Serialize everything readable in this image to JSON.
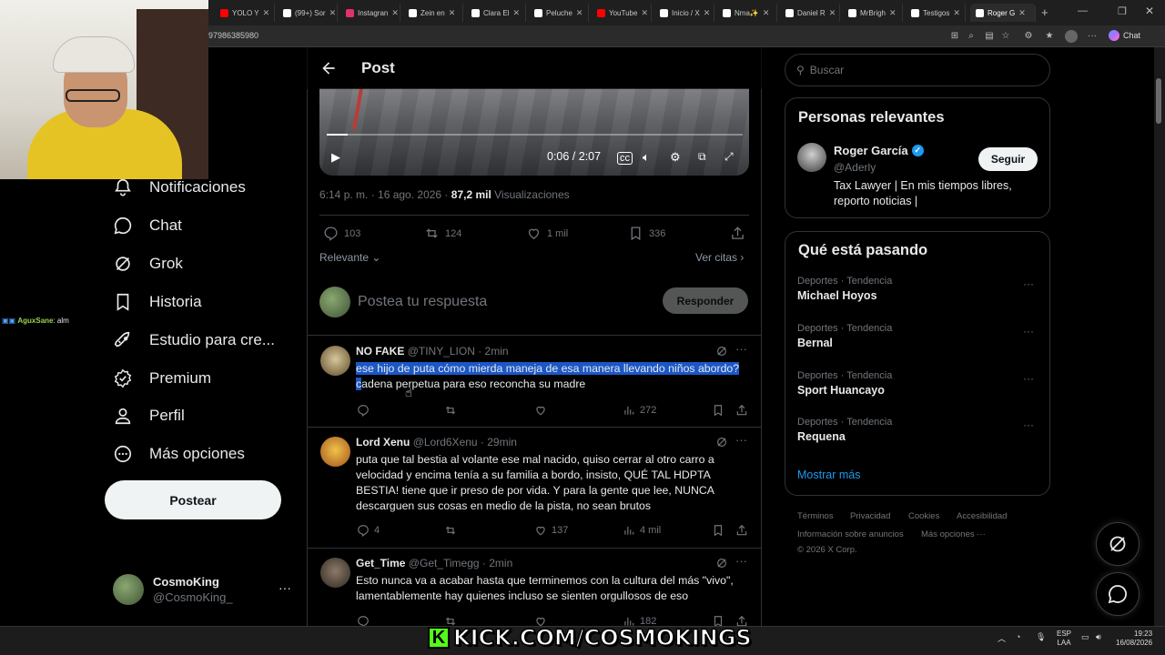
{
  "browser": {
    "tabs": [
      {
        "label": "YOLO Y",
        "color": "#ff0000",
        "active": false
      },
      {
        "label": "(99+) Sor",
        "color": "#ffffff",
        "active": false
      },
      {
        "label": "Instagran",
        "color": "#e1306c",
        "active": false
      },
      {
        "label": "Zein en",
        "color": "#ffffff",
        "active": false
      },
      {
        "label": "Clara El",
        "color": "#ffffff",
        "active": false
      },
      {
        "label": "Peluche",
        "color": "#ffffff",
        "active": false
      },
      {
        "label": "YouTube",
        "color": "#ff0000",
        "active": false
      },
      {
        "label": "Inicio / X",
        "color": "#ffffff",
        "active": false
      },
      {
        "label": "Nma✨",
        "color": "#ffffff",
        "active": false
      },
      {
        "label": "Daniel R",
        "color": "#ffffff",
        "active": false
      },
      {
        "label": "MrBrigh",
        "color": "#ffffff",
        "active": false
      },
      {
        "label": "Testigos",
        "color": "#ffffff",
        "active": false
      },
      {
        "label": "Roger G",
        "color": "#ffffff",
        "active": true
      }
    ],
    "url": "97986385980",
    "chat_label": "Chat"
  },
  "stream": {
    "chat_user": "AguxSane",
    "chat_msg": ": alm",
    "banner": "KICK.COM/COSMOKINGS",
    "banner_k": "K"
  },
  "nav": {
    "items": [
      {
        "label": "Notificaciones",
        "icon": "bell-icon"
      },
      {
        "label": "Chat",
        "icon": "chat-icon"
      },
      {
        "label": "Grok",
        "icon": "grok-icon"
      },
      {
        "label": "Historia",
        "icon": "bookmark-icon"
      },
      {
        "label": "Estudio para cre...",
        "icon": "rocket-icon"
      },
      {
        "label": "Premium",
        "icon": "premium-icon"
      },
      {
        "label": "Perfil",
        "icon": "profile-icon"
      },
      {
        "label": "Más opciones",
        "icon": "more-icon"
      }
    ],
    "post_button": "Postear",
    "account_name": "CosmoKing",
    "account_handle": "@CosmoKing_"
  },
  "post": {
    "title": "Post",
    "video_time": "0:06 / 2:07",
    "video_progress": 0.05,
    "timestamp": "6:14 p. m. · 16 ago. 2026 · ",
    "views": "87,2 mil",
    "views_label": " Visualizaciones",
    "stats": {
      "replies": "103",
      "reposts": "124",
      "likes": "1 mil",
      "bookmarks": "336"
    },
    "sort_label": "Relevante",
    "quotes_label": "Ver citas",
    "reply_placeholder": "Postea tu respuesta",
    "reply_button": "Responder"
  },
  "replies": [
    {
      "name": "NO FAKE",
      "handle": "@TINY_LION · 2min",
      "text_highlight": "ese hijo de puta cómo mierda maneja de esa manera llevando niños abordo? c",
      "text": "adena perpetua para eso reconcha su madre",
      "replies": "",
      "reposts": "",
      "likes": "",
      "views": "272"
    },
    {
      "name": "Lord Xenu",
      "handle": "@Lord6Xenu · 29min",
      "text_highlight": "",
      "text": "puta que tal bestia al volante ese mal nacido, quiso cerrar al otro carro a velocidad y encima tenía a su familia a bordo, insisto, QUÉ TAL HDPTA BESTIA! tiene que ir preso de por vida. Y para la gente que lee, NUNCA descarguen sus cosas en medio de la pista, no sean brutos",
      "replies": "4",
      "reposts": "",
      "likes": "137",
      "views": "4 mil"
    },
    {
      "name": "Get_Time",
      "handle": "@Get_Timegg · 2min",
      "text_highlight": "",
      "text": "Esto nunca va a acabar hasta que terminemos con la cultura del más \"vivo\", lamentablemente hay quienes incluso se sienten orgullosos de eso",
      "replies": "",
      "reposts": "",
      "likes": "",
      "views": "182"
    }
  ],
  "sidebar": {
    "search_placeholder": "Buscar",
    "relevant_title": "Personas relevantes",
    "person": {
      "name": "Roger García",
      "handle": "@Aderly",
      "bio": "Tax Lawyer | En mis tiempos libres, reporto noticias |",
      "follow_label": "Seguir"
    },
    "trends_title": "Qué está pasando",
    "trends": [
      {
        "category": "Deportes · Tendencia",
        "name": "Michael Hoyos"
      },
      {
        "category": "Deportes · Tendencia",
        "name": "Bernal"
      },
      {
        "category": "Deportes · Tendencia",
        "name": "Sport Huancayo"
      },
      {
        "category": "Deportes · Tendencia",
        "name": "Requena"
      }
    ],
    "show_more": "Mostrar más",
    "footer_line1": [
      "Términos",
      "Privacidad",
      "Cookies",
      "Accesibilidad"
    ],
    "footer_line2": [
      "Información sobre anuncios",
      "Más opciones ···"
    ],
    "copyright": "© 2026 X Corp."
  },
  "taskbar": {
    "lang": "ESP",
    "region": "LAA",
    "time": "19:23",
    "date": "16/08/2026"
  },
  "colors": {
    "accent": "#1d9bf0",
    "highlight": "#1b57c6",
    "kick": "#53fc18"
  }
}
